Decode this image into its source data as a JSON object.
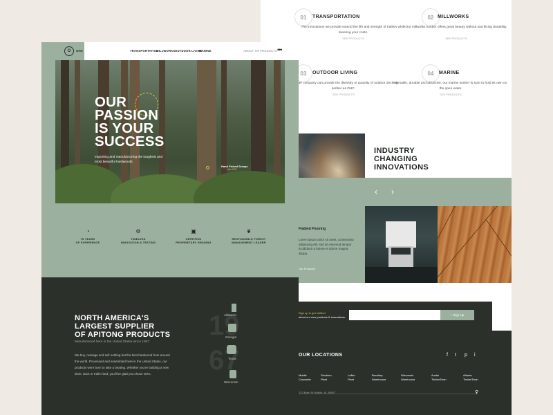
{
  "services": [
    {
      "num": "01",
      "title": "TRANSPORTATION",
      "desc": "The innovations we provide extend the life and strength of trailers while lowering your costs.",
      "link": "SEE PRODUCTS"
    },
    {
      "num": "02",
      "title": "MILLWORKS",
      "desc": "Our millworks lumber offers great beauty without sacrificing durability.",
      "link": "SEE PRODUCTS"
    },
    {
      "num": "03",
      "title": "OUTDOOR LIVING",
      "desc": "No other company can provide the diversity or quantity of outdoor decking lumber as OHC.",
      "link": "SEE PRODUCTS"
    },
    {
      "num": "04",
      "title": "MARINE",
      "desc": "Versatile, durable and attractive, our marine lumber is sure to hold its own on the open water.",
      "link": "SEE PRODUCTS"
    }
  ],
  "innovations": {
    "title_line1": "INDUSTRY",
    "title_line2": "CHANGING",
    "title_line3": "INNOVATIONS",
    "prev": "‹",
    "next": "›",
    "card_title": "Flatbed Flooring",
    "card_desc": "Lorem ipsum dolor sit amet, consectetur adipiscing elit, sed do eiusmod tempor incididunt ut labore et dolore magna aliqua.",
    "card_link": "Our Products"
  },
  "newsletter": {
    "text_highlight": "Sign up to get notified",
    "text_rest": "about our new products & innovations.",
    "input_placeholder": "",
    "button": "+ Sign Up"
  },
  "footer": {
    "title": "OUR LOCATIONS",
    "social": [
      "f",
      "t",
      "p",
      "i"
    ],
    "locations": [
      "Mobile\nCorporate",
      "Stockton\nPlant",
      "Lufkin\nPlant",
      "Brookley\nWarehouse",
      "Wisconsin\nWarehouse",
      "Austin\nTimberTown",
      "Atlanta\nTimberTown"
    ],
    "address": "123 Main St Mobile, AL 36607"
  },
  "nav": {
    "logo": "OHC",
    "logo_mark": "O",
    "items": [
      "TRANSPORTATION",
      "MILLWORKS",
      "OUTDOOR LIVING",
      "MARINE"
    ],
    "right_items": [
      "ABOUT US",
      "PRODUCTS"
    ],
    "more": "•••"
  },
  "hero": {
    "title_line1": "OUR",
    "title_line2": "PASSION",
    "title_line3": "IS YOUR",
    "title_line4": "SUCCESS",
    "subtitle": "Importing and manufacturing the toughest and most beautiful hardwoods.",
    "hotspot_label": "Hand Picked Scraps",
    "hotspot_sub": "Live SSO"
  },
  "features": [
    {
      "icon": "◔",
      "icon_name": "clock-icon",
      "label": "75 YEARS\nOF EXPERIENCE"
    },
    {
      "icon": "⚙",
      "icon_name": "innovation-icon",
      "label": "TIMELESS\nINNOVATION & TESTING"
    },
    {
      "icon": "▣",
      "icon_name": "grading-icon",
      "label": "CERTIFIED\nPROPRIETARY GRADING"
    },
    {
      "icon": "❦",
      "icon_name": "leaf-icon",
      "label": "RESPONSIBLE FOREST\nMANAGEMENT LEADER"
    }
  ],
  "about": {
    "title_line1": "NORTH AMERICA'S",
    "title_line2": "LARGEST SUPPLIER",
    "title_line3": "OF APITONG PRODUCTS",
    "subtitle": "Manufactured here in the United States since 1967",
    "body": "We buy, manage and sell nothing but the best hardwood from around the world. Processed and assembled here in the United States, our products were born to take a beating. Whether you're building a new deck, dock or trailer bed, you'll be glad you chose OHC.",
    "year_digits": [
      "19",
      "67"
    ],
    "states": [
      "Alabama",
      "Georgia",
      "Texas",
      "Wisconsin"
    ]
  },
  "colors": {
    "sage": "#9bb09e",
    "dark": "#2b302b",
    "gold": "#e0c24a",
    "background": "#efeae4"
  }
}
